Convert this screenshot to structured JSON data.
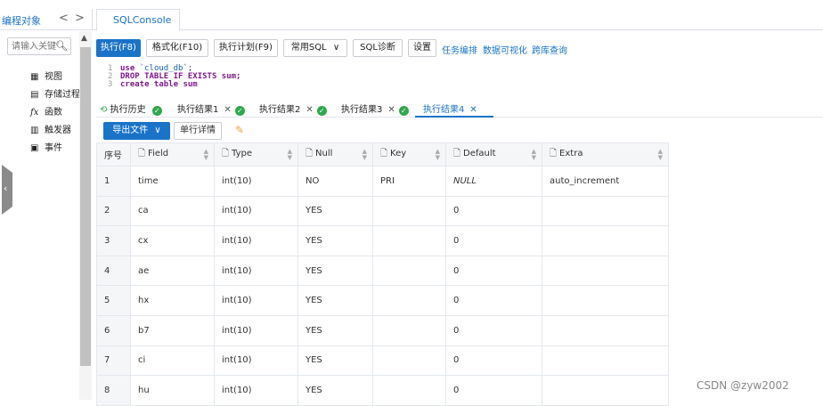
{
  "top": {
    "object_tab": "编程对象",
    "nav_prev": "<",
    "nav_next": ">",
    "console_tab": "SQLConsole"
  },
  "sidebar": {
    "search_placeholder": "请输入关键",
    "items": [
      {
        "icon": "view-icon",
        "label": "视图"
      },
      {
        "icon": "procedure-icon",
        "label": "存储过程"
      },
      {
        "icon": "function-icon",
        "label": "函数"
      },
      {
        "icon": "trigger-icon",
        "label": "触发器"
      },
      {
        "icon": "event-icon",
        "label": "事件"
      }
    ]
  },
  "toolbar": {
    "execute": "执行(F8)",
    "format": "格式化(F10)",
    "plan": "执行计划(F9)",
    "common_sql": "常用SQL",
    "diagnose": "SQL诊断",
    "settings": "设置",
    "links": [
      "任务编排",
      "数据可视化",
      "跨库查询"
    ]
  },
  "editor": {
    "lines": [
      {
        "num": "1",
        "kw": "use ",
        "str": "`cloud_db`",
        "rest": ";"
      },
      {
        "num": "2",
        "kw": "DROP TABLE IF EXISTS sum;",
        "str": "",
        "rest": ""
      },
      {
        "num": "3",
        "kw": "create table sum",
        "str": "",
        "rest": ""
      }
    ]
  },
  "result_tabs": {
    "history": "执行历史",
    "tabs": [
      "执行结果1",
      "执行结果2",
      "执行结果3",
      "执行结果4"
    ],
    "active": "执行结果4"
  },
  "result_toolbar": {
    "export": "导出文件",
    "row_detail": "单行详情"
  },
  "table": {
    "columns": [
      "序号",
      "Field",
      "Type",
      "Null",
      "Key",
      "Default",
      "Extra"
    ],
    "rows": [
      [
        "1",
        "time",
        "int(10)",
        "NO",
        "PRI",
        "NULL",
        "auto_increment"
      ],
      [
        "2",
        "ca",
        "int(10)",
        "YES",
        "",
        "0",
        ""
      ],
      [
        "3",
        "cx",
        "int(10)",
        "YES",
        "",
        "0",
        ""
      ],
      [
        "4",
        "ae",
        "int(10)",
        "YES",
        "",
        "0",
        ""
      ],
      [
        "5",
        "hx",
        "int(10)",
        "YES",
        "",
        "0",
        ""
      ],
      [
        "6",
        "b7",
        "int(10)",
        "YES",
        "",
        "0",
        ""
      ],
      [
        "7",
        "ci",
        "int(10)",
        "YES",
        "",
        "0",
        ""
      ],
      [
        "8",
        "hu",
        "int(10)",
        "YES",
        "",
        "0",
        ""
      ]
    ]
  },
  "watermark": "CSDN @zyw2002",
  "colors": {
    "accent": "#1a73c8",
    "success": "#2fa84f",
    "code_keyword": "#7c1a8c"
  }
}
